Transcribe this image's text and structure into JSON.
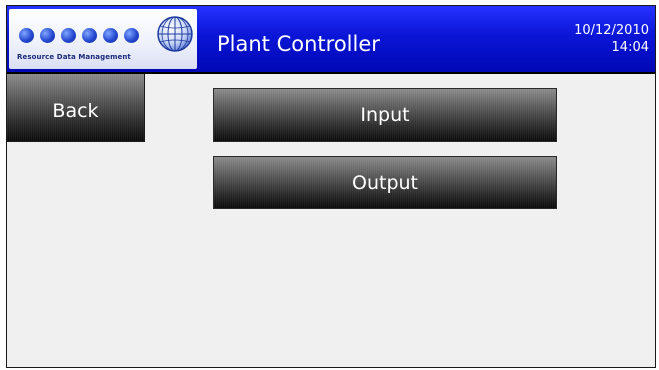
{
  "header": {
    "logo_text": "Resource Data Management",
    "title": "Plant Controller",
    "date": "10/12/2010",
    "time": "14:04"
  },
  "nav": {
    "back_label": "Back"
  },
  "menu": {
    "input_label": "Input",
    "output_label": "Output"
  },
  "icons": {
    "logo": "globe-icon"
  },
  "colors": {
    "header": "#0b15d6",
    "screen_bg": "#f0f0f0",
    "button": "#2a2a2a"
  }
}
